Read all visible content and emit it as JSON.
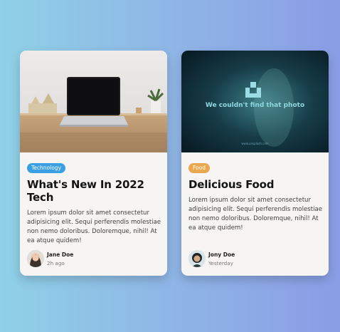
{
  "cards": [
    {
      "tag": "Technology",
      "tag_color": "#3aa0e3",
      "title": "What's New In 2022 Tech",
      "description": "Lorem ipsum dolor sit amet consectetur adipisicing elit. Sequi perferendis molestiae non nemo doloribus. Doloremque, nihil! At ea atque quidem!",
      "author": "Jane Doe",
      "time": "2h ago",
      "image": "laptop-on-desk-photo"
    },
    {
      "tag": "Food",
      "tag_color": "#e9a84e",
      "title": "Delicious Food",
      "description": "Lorem ipsum dolor sit amet consectetur adipisicing elit. Sequi perferendis molestiae non nemo doloribus. Doloremque, nihil! At ea atque quidem!",
      "author": "Jony Doe",
      "time": "Yesterday",
      "image": "unavailable-photo-placeholder",
      "image_message": "We couldn't find that photo",
      "image_caption": "www.unsplash.com"
    }
  ]
}
